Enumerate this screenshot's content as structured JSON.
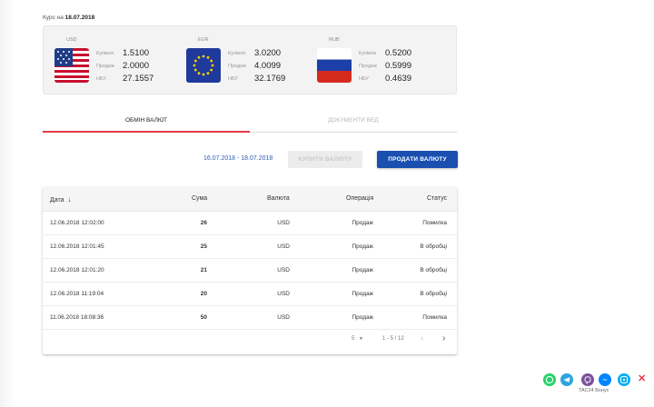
{
  "header": {
    "rate_label": "Курс на",
    "rate_date": "18.07.2018"
  },
  "rates": [
    {
      "code": "USD",
      "flag": "us-flag-icon",
      "buy_label": "Купівля",
      "buy": "1.5100",
      "sell_label": "Продаж",
      "sell": "2.0000",
      "nbu_label": "НБУ",
      "nbu": "27.1557"
    },
    {
      "code": "EUR",
      "flag": "eu-flag-icon",
      "buy_label": "Купівля",
      "buy": "3.0200",
      "sell_label": "Продаж",
      "sell": "4.0099",
      "nbu_label": "НБУ",
      "nbu": "32.1769"
    },
    {
      "code": "RUB",
      "flag": "ru-flag-icon",
      "buy_label": "Купівля",
      "buy": "0.5200",
      "sell_label": "Продаж",
      "sell": "0.5999",
      "nbu_label": "НБУ",
      "nbu": "0.4639"
    }
  ],
  "tabs": [
    {
      "label": "ОБМІН ВАЛЮТ",
      "active": true
    },
    {
      "label": "ДОКУМЕНТИ ВЕД",
      "active": false
    }
  ],
  "toolbar": {
    "date_range": "16.07.2018 - 18.07.2018",
    "buy_label": "КУПИТИ ВАЛЮТУ",
    "sell_label": "ПРОДАТИ ВАЛЮТУ"
  },
  "table": {
    "columns": [
      "Дата",
      "Сума",
      "Валюта",
      "Операція",
      "Статус"
    ],
    "rows": [
      {
        "date": "12.06.2018 12:02:00",
        "sum": "26",
        "currency": "USD",
        "operation": "Продаж",
        "status": "Помилка"
      },
      {
        "date": "12.06.2018 12:01:45",
        "sum": "25",
        "currency": "USD",
        "operation": "Продаж",
        "status": "В обробці"
      },
      {
        "date": "12.06.2018 12:01:20",
        "sum": "21",
        "currency": "USD",
        "operation": "Продаж",
        "status": "В обробці"
      },
      {
        "date": "12.06.2018 11:19:04",
        "sum": "20",
        "currency": "USD",
        "operation": "Продаж",
        "status": "В обробці"
      },
      {
        "date": "11.06.2018 18:08:36",
        "sum": "50",
        "currency": "USD",
        "operation": "Продаж",
        "status": "Помилка"
      }
    ],
    "pagination": {
      "per_page": "5",
      "range": "1 - 5 / 12"
    }
  },
  "social": {
    "icons": [
      "whatsapp-icon",
      "telegram-icon",
      "viber-icon",
      "messenger-icon",
      "skype-icon"
    ],
    "colors": [
      "#25d366",
      "#2ca5e0",
      "#7b519d",
      "#0084ff",
      "#00aff0"
    ],
    "brand": "TAC24 Бонус"
  },
  "colors": {
    "accent_red": "#e53946",
    "primary_blue": "#1a4fb0",
    "link_blue": "#2d5fb3"
  }
}
